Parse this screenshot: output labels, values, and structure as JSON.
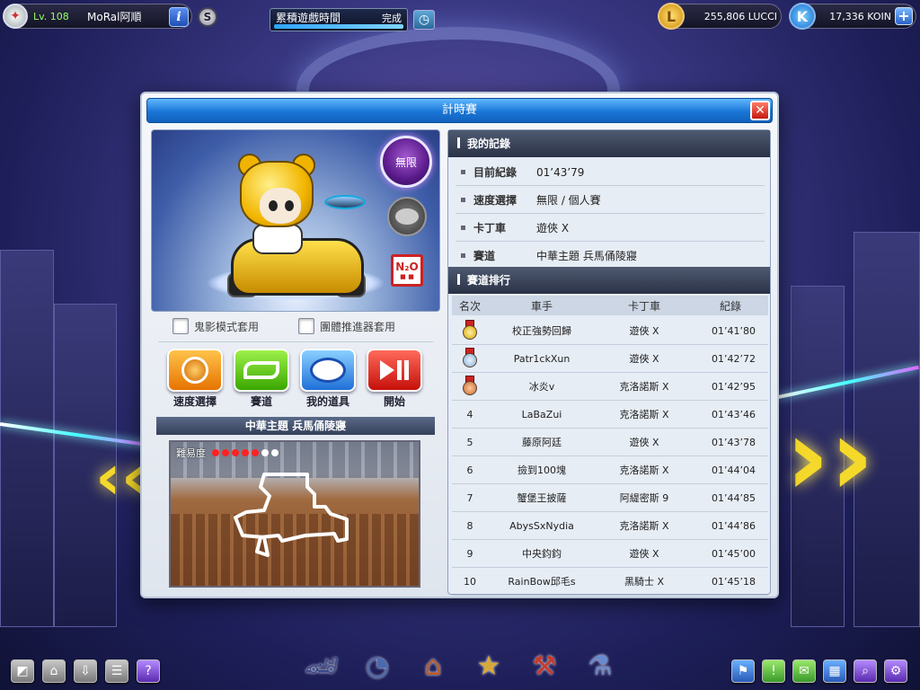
{
  "hud": {
    "level": "Lv. 108",
    "username": "MoRal阿順",
    "info_icon": "i",
    "s_icon": "S",
    "playtime_label": "累積遊戲時間",
    "playtime_status": "完成",
    "playtime_progress_pct": 100,
    "lucci_amount": "255,806 LUCCI",
    "lucci_icon": "L",
    "koin_amount": "17,336 KOIN",
    "koin_icon": "K",
    "plus": "+"
  },
  "modal": {
    "title": "計時賽",
    "close": "✕",
    "speed_badge": "無限",
    "n2o_label": "N₂O",
    "n2o_sub": "■ ■",
    "options": {
      "ghost_mode": "鬼影模式套用",
      "team_boost": "團體推進器套用"
    },
    "actions": {
      "speed": "速度選擇",
      "track": "賽道",
      "items": "我的道具",
      "start": "開始"
    },
    "track_name": "中華主題 兵馬俑陵寢",
    "difficulty_label": "難易度",
    "difficulty_level": 5,
    "difficulty_max": 7
  },
  "my_record": {
    "header": "我的記錄",
    "rows": [
      {
        "key": "目前紀錄",
        "value": "01’43’79"
      },
      {
        "key": "速度選擇",
        "value": "無限 / 個人賽"
      },
      {
        "key": "卡丁車",
        "value": "遊俠 X"
      },
      {
        "key": "賽道",
        "value": "中華主題 兵馬俑陵寢"
      }
    ]
  },
  "ranking": {
    "header": "賽道排行",
    "columns": {
      "rank": "名次",
      "driver": "車手",
      "kart": "卡丁車",
      "time": "紀錄"
    },
    "rows": [
      {
        "rank": "1",
        "medal": "gold",
        "driver": "校正強勢回歸",
        "kart": "遊俠 X",
        "time": "01’41’80"
      },
      {
        "rank": "2",
        "medal": "silver",
        "driver": "Patr1ckXun",
        "kart": "遊俠 X",
        "time": "01’42’72"
      },
      {
        "rank": "3",
        "medal": "bronze",
        "driver": "冰炎v",
        "kart": "克洛諾斯 X",
        "time": "01’42’95"
      },
      {
        "rank": "4",
        "medal": "",
        "driver": "LaBaZui",
        "kart": "克洛諾斯 X",
        "time": "01’43’46"
      },
      {
        "rank": "5",
        "medal": "",
        "driver": "藤原阿廷",
        "kart": "遊俠 X",
        "time": "01’43’78"
      },
      {
        "rank": "6",
        "medal": "",
        "driver": "撿到100塊",
        "kart": "克洛諾斯 X",
        "time": "01’44’04"
      },
      {
        "rank": "7",
        "medal": "",
        "driver": "蟹堡王披薩",
        "kart": "阿緹密斯 9",
        "time": "01’44’85"
      },
      {
        "rank": "8",
        "medal": "",
        "driver": "AbysSxNydia",
        "kart": "克洛諾斯 X",
        "time": "01’44’86"
      },
      {
        "rank": "9",
        "medal": "",
        "driver": "中央鈞鈞",
        "kart": "遊俠 X",
        "time": "01’45’00"
      },
      {
        "rank": "10",
        "medal": "",
        "driver": "RainBow邱毛s",
        "kart": "黑騎士 X",
        "time": "01’45’18"
      }
    ]
  },
  "bottom_bar": {
    "left_icons": [
      "cube-icon",
      "home-icon",
      "download-icon",
      "notes-icon",
      "help-icon"
    ],
    "center_icons": [
      "race-kart-icon",
      "speedometer-icon",
      "garage-icon",
      "shop-icon",
      "toolbox-icon",
      "lab-icon"
    ],
    "right_icons": [
      "flag-icon",
      "alert-icon",
      "chat-icon",
      "board-icon",
      "search-icon",
      "settings-icon"
    ],
    "help_glyph": "?",
    "alert_glyph": "!"
  },
  "colors": {
    "title_bar": "#1a76d6",
    "section_header": "#2a3246",
    "difficulty_on": "#ff2222",
    "accent_yellow": "#f5d92a"
  }
}
